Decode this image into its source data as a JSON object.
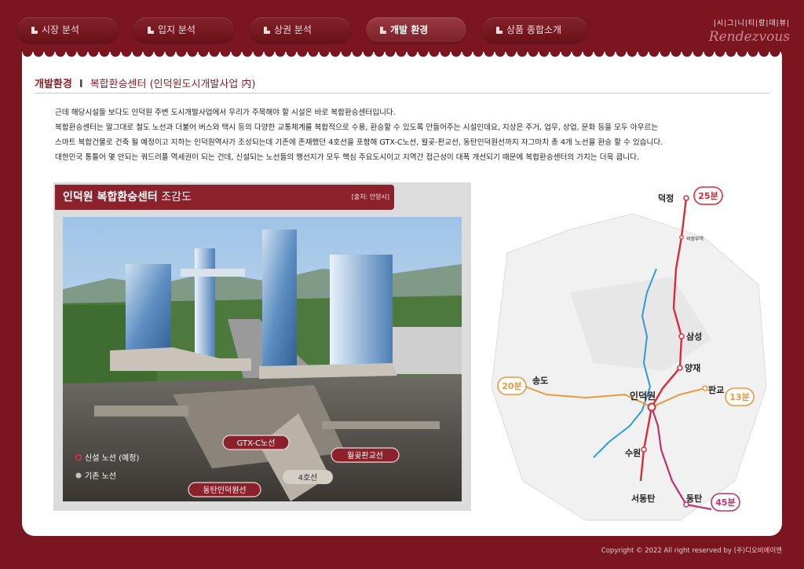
{
  "nav": {
    "tabs": [
      {
        "label": "시장 분석",
        "active": false
      },
      {
        "label": "입지 분석",
        "active": false
      },
      {
        "label": "상권 분석",
        "active": false
      },
      {
        "label": "개발 환경",
        "active": true
      },
      {
        "label": "상품 종합소개",
        "active": false
      }
    ]
  },
  "brand": {
    "letters": "|시|그|니|티|랑|데|뷰|",
    "script": "Rendezvous"
  },
  "page": {
    "section": "개발환경",
    "separator": "I",
    "subtitle": "복합환승센터 (인덕원도시개발사업 内)"
  },
  "body": {
    "lines": [
      "근데 해당시설들 보다도 인덕원 주변 도시개발사업에서 우리가 주목해야 할 시설은 바로 복합환승센터입니다.",
      "복합환승센터는 말그대로 철도 노선과 더불어 버스와 택시 등의 다양한 교통체계를 복합적으로 수용, 환승할 수 있도록 만들어주는 시설인데요, 지상은 주거, 업무, 상업, 문화 등을 모두 아우르는",
      "스마트 복합건물로 건축 될 예정이고 지하는 인덕원역사가 조성되는데 기존에 존재했던 4호선을 포함해 GTX-C노선, 월곶-판교선, 동탄인덕원선까지 자그마치 총 4개 노선을 환승 할 수 있습니다.",
      "대한민국 통틀어 몇 안되는 쿼드러플 역세권이 되는 건데, 신설되는 노선들의 행선지가 모두 핵심 주요도시이고 지역간 접근성이 대폭 개선되기 때문에 복합환승센터의 가치는 더욱 큽니다."
    ]
  },
  "rendering": {
    "title_bold": "인덕원 복합환승센터",
    "title_thin": " 조감도",
    "source": "[출처: 안양시]",
    "legend_new": "신설 노선 (예정)",
    "legend_existing": "기존 노선",
    "labels": {
      "gtx": "GTX-C노선",
      "wolgot": "월곶판교선",
      "line4": "4호선",
      "dongtan": "동탄인덕원선"
    }
  },
  "map": {
    "stations": {
      "deokjeong": "덕정",
      "samseong": "삼성",
      "yangjae": "양재",
      "pangyo": "판교",
      "songdo": "송도",
      "indeogwon": "인덕원",
      "suwon": "수원",
      "seodongtan": "서동탄",
      "dongtan": "동탄",
      "uijeongbu": "의정부역"
    },
    "times": {
      "deokjeong": "25분",
      "songdo": "20분",
      "pangyo": "13분",
      "dongtan": "45분"
    }
  },
  "footer": {
    "copyright": "Copyright © 2022 All right reserved by (주)디오비에이엔"
  },
  "colors": {
    "brand": "#7b1620",
    "accent": "#8b222b",
    "gtx": "#d92b3a",
    "new_line": "#c0306b",
    "line4": "#2f9bd6",
    "wolgot": "#e89a3c"
  }
}
